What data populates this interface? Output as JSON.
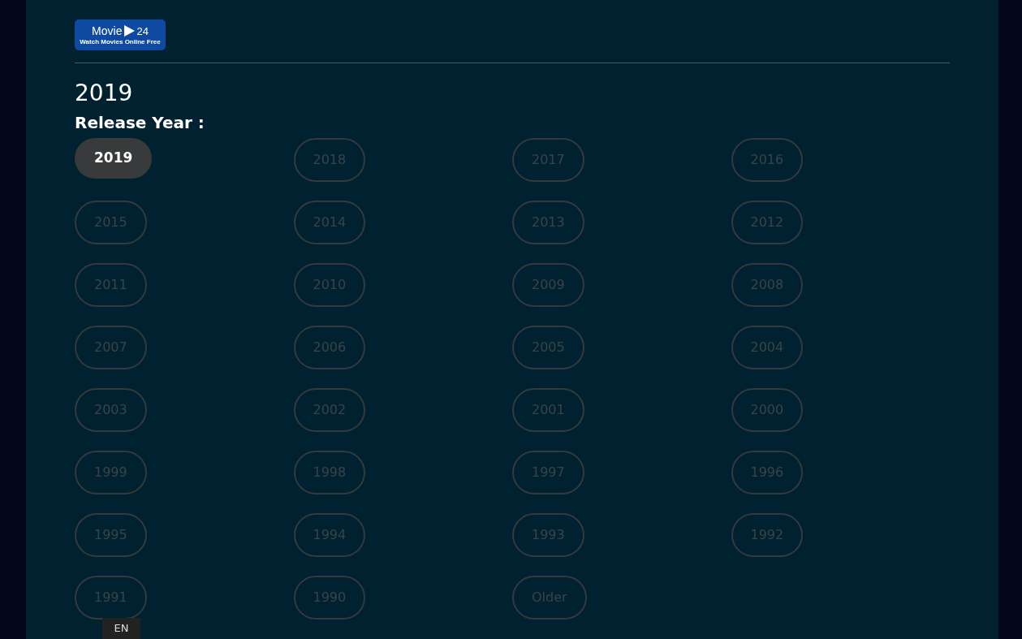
{
  "logo": {
    "name": "Movie",
    "number": "24",
    "tagline": "Watch Movies Online Free"
  },
  "title": "2019",
  "filter_label": "Release Year :",
  "years": [
    {
      "label": "2019",
      "selected": true
    },
    {
      "label": "2018",
      "selected": false
    },
    {
      "label": "2017",
      "selected": false
    },
    {
      "label": "2016",
      "selected": false
    },
    {
      "label": "2015",
      "selected": false
    },
    {
      "label": "2014",
      "selected": false
    },
    {
      "label": "2013",
      "selected": false
    },
    {
      "label": "2012",
      "selected": false
    },
    {
      "label": "2011",
      "selected": false
    },
    {
      "label": "2010",
      "selected": false
    },
    {
      "label": "2009",
      "selected": false
    },
    {
      "label": "2008",
      "selected": false
    },
    {
      "label": "2007",
      "selected": false
    },
    {
      "label": "2006",
      "selected": false
    },
    {
      "label": "2005",
      "selected": false
    },
    {
      "label": "2004",
      "selected": false
    },
    {
      "label": "2003",
      "selected": false
    },
    {
      "label": "2002",
      "selected": false
    },
    {
      "label": "2001",
      "selected": false
    },
    {
      "label": "2000",
      "selected": false
    },
    {
      "label": "1999",
      "selected": false
    },
    {
      "label": "1998",
      "selected": false
    },
    {
      "label": "1997",
      "selected": false
    },
    {
      "label": "1996",
      "selected": false
    },
    {
      "label": "1995",
      "selected": false
    },
    {
      "label": "1994",
      "selected": false
    },
    {
      "label": "1993",
      "selected": false
    },
    {
      "label": "1992",
      "selected": false
    },
    {
      "label": "1991",
      "selected": false
    },
    {
      "label": "1990",
      "selected": false
    },
    {
      "label": "Older",
      "selected": false
    }
  ],
  "language_badge": "EN"
}
